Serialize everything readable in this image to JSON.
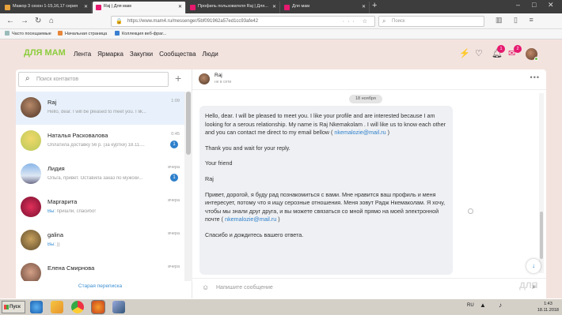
{
  "browser": {
    "tabs": [
      {
        "title": "Мажор 3 сезон 1-15,16,17 серия",
        "active": false,
        "favicon_color": "#e8a33d"
      },
      {
        "title": "Raj | Для мам",
        "active": true,
        "favicon_color": "#e6196f"
      },
      {
        "title": "Профиль пользователя Raj | Для...",
        "active": false,
        "favicon_color": "#e6196f"
      },
      {
        "title": "Для мам",
        "active": false,
        "favicon_color": "#e6196f"
      }
    ],
    "url": "https://www.mam4.ru/messenger/5bf091962a57ed1cc93afe42",
    "search_placeholder": "Поиск",
    "bookmarks": [
      "Часто посещаемые",
      "Начальная страница",
      "Коллекция веб-фраг..."
    ]
  },
  "site": {
    "logo": "ДЛЯ МАМ",
    "nav": [
      "Лента",
      "Ярмарка",
      "Закупки",
      "Сообщества",
      "Люди"
    ],
    "notifications_count": "1",
    "messages_count": "2",
    "brand_color": "#8ccd3c",
    "accent_color": "#e6196f"
  },
  "contacts": {
    "search_placeholder": "Поиск контактов",
    "list": [
      {
        "name": "Raj",
        "time": "1:09",
        "preview": "Hello, dear. I will be pleased to meet you. I lik...",
        "preview_prefix": "",
        "badge": "",
        "selected": true,
        "avatar": "radial-gradient(circle at 45% 40%, #b88a6a, #4e3426)"
      },
      {
        "name": "Наталья Расковалова",
        "time": "0:45",
        "preview": "Оплатила доставку 56 р. (за куртки) 18.11....",
        "preview_prefix": "",
        "badge": "1",
        "selected": false,
        "avatar": "radial-gradient(circle at 50% 40%, #f1d86a, #b7c95a)"
      },
      {
        "name": "Лидия",
        "time": "вчера",
        "preview": "Ольга, привет. Оставила заказ по мужски...",
        "preview_prefix": "",
        "badge": "1",
        "selected": false,
        "avatar": "linear-gradient(180deg, #8ab6e8 0%, #dce7f3 60%, #6e6e8a 100%)"
      },
      {
        "name": "Маргарита",
        "time": "вчера",
        "preview": " пришли, спасибо!",
        "preview_prefix": "Вы:",
        "badge": "",
        "selected": false,
        "avatar": "radial-gradient(circle at 50% 50%, #e0305a, #7a1030)"
      },
      {
        "name": "galina",
        "time": "вчера",
        "preview": " ))",
        "preview_prefix": "Вы:",
        "badge": "",
        "selected": false,
        "avatar": "radial-gradient(circle at 50% 45%, #c9a25f, #5d4a2a)"
      },
      {
        "name": "Елена Смирнова",
        "time": "вчера",
        "preview": "",
        "preview_prefix": "",
        "badge": "",
        "selected": false,
        "avatar": "radial-gradient(circle at 50% 45%, #d4a088, #6b4a3a)"
      }
    ],
    "old_conversations": "Старая переписка"
  },
  "chat": {
    "name": "Raj",
    "status": "не в сети",
    "date": "18 ноября",
    "message": {
      "p1": "Hello, dear. I will be pleased to meet you. I like your profile and are interested because I am looking for a serous relationship. My name is Raj Nkemakolam . I will like us to know each other and  you can contact me direct to my email bellow ( ",
      "email1": "nkemalozie@mail.ru",
      "p1_end": " )",
      "p2": "Thank you and wait for your reply.",
      "p3": "Your friend",
      "p4": "Raj",
      "p5": "Привет, дорогой, я буду рад познакомиться с вами. Мне нравится ваш профиль и меня интересует, потому что я ищу серозные отношения. Меня зовут Радж Нкемаколам. Я хочу, чтобы мы знали друг друга, и вы можете связаться со мной прямо на моей электронной почте ( ",
      "email2": "nkemalozie@mail.ru",
      "p5_end": " )",
      "p6": "Спасибо и дождитесь вашего ответа."
    },
    "composer_placeholder": "Напишите сообщение"
  },
  "taskbar": {
    "start": "Пуск",
    "lang": "RU",
    "time": "1:43",
    "date": "18.11.2018"
  },
  "watermark": "ДЛЯ"
}
